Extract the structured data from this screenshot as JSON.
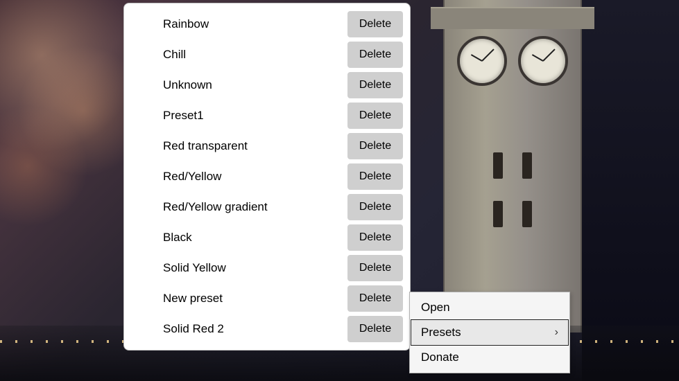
{
  "presets": {
    "delete_label": "Delete",
    "items": [
      {
        "name": "Rainbow"
      },
      {
        "name": "Chill"
      },
      {
        "name": "Unknown"
      },
      {
        "name": "Preset1"
      },
      {
        "name": "Red transparent"
      },
      {
        "name": "Red/Yellow"
      },
      {
        "name": "Red/Yellow gradient"
      },
      {
        "name": "Black"
      },
      {
        "name": "Solid Yellow"
      },
      {
        "name": "New preset"
      },
      {
        "name": "Solid Red 2"
      }
    ]
  },
  "context_menu": {
    "items": [
      {
        "label": "Open",
        "has_submenu": false,
        "highlighted": false
      },
      {
        "label": "Presets",
        "has_submenu": true,
        "highlighted": true
      },
      {
        "label": "Donate",
        "has_submenu": false,
        "highlighted": false
      }
    ]
  }
}
